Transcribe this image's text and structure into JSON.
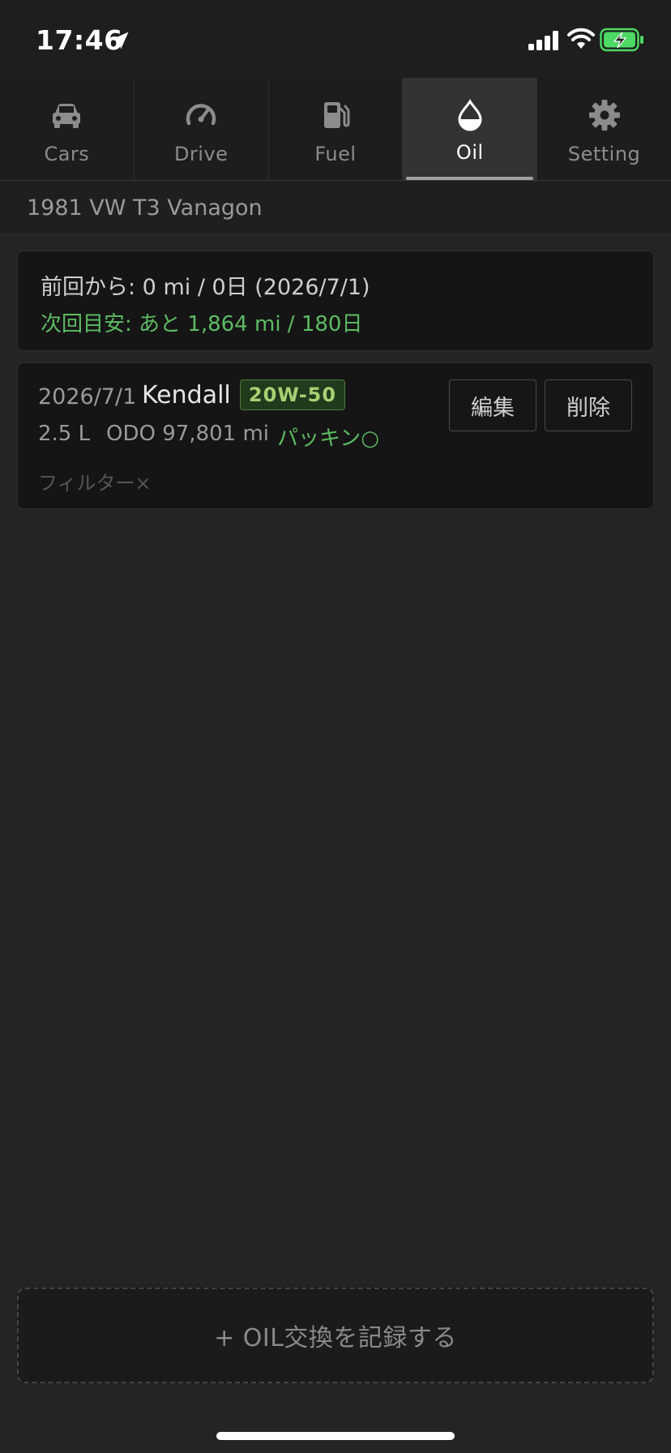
{
  "status_bar": {
    "time": "17:46"
  },
  "tabs": [
    {
      "label": "Cars",
      "icon": "car-icon",
      "active": false
    },
    {
      "label": "Drive",
      "icon": "speedometer-icon",
      "active": false
    },
    {
      "label": "Fuel",
      "icon": "fuel-pump-icon",
      "active": false
    },
    {
      "label": "Oil",
      "icon": "oil-drop-icon",
      "active": true
    },
    {
      "label": "Setting",
      "icon": "gear-icon",
      "active": false
    }
  ],
  "vehicle": {
    "name": "1981 VW T3 Vanagon"
  },
  "summary": {
    "since_last": "前回から: 0 mi / 0日 (2026/7/1)",
    "next_target": "次回目安: あと 1,864 mi / 180日"
  },
  "records": [
    {
      "date": "2026/7/1",
      "brand": "Kendall",
      "grade": "20W-50",
      "amount": "2.5 L",
      "odo": "ODO 97,801 mi",
      "packing": "パッキン○",
      "filter": "フィルター×",
      "edit_label": "編集",
      "delete_label": "削除"
    }
  ],
  "add_button": {
    "label": "+ OIL交換を記録する"
  },
  "colors": {
    "background": "#242424",
    "accent_green": "#5dbb63",
    "grade_badge": "#a6d174",
    "battery": "#4cd964"
  }
}
